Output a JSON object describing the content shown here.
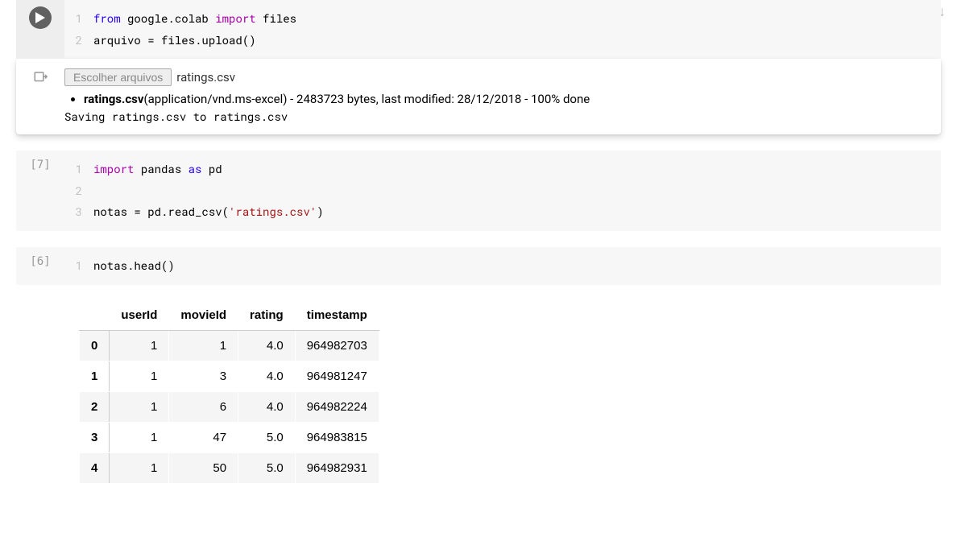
{
  "nav": {
    "up_glyph": "↑",
    "down_glyph": "↓"
  },
  "cell1": {
    "code_lines": [
      {
        "n": "1",
        "parts": [
          {
            "t": "from ",
            "cls": "kw"
          },
          {
            "t": "google.colab ",
            "cls": ""
          },
          {
            "t": "import ",
            "cls": "kw2"
          },
          {
            "t": "files",
            "cls": ""
          }
        ]
      },
      {
        "n": "2",
        "parts": [
          {
            "t": "arquivo = files.upload()",
            "cls": ""
          }
        ]
      }
    ],
    "choose_label": "Escolher arquivos",
    "chosen_file": "ratings.csv",
    "file_detail_name": "ratings.csv",
    "file_detail_meta": "(application/vnd.ms-excel) - 2483723 bytes, last modified: 28/12/2018 - 100% done",
    "saving_line": "Saving ratings.csv to ratings.csv"
  },
  "cell2": {
    "exec_label": "[7]",
    "code_lines": [
      {
        "n": "1",
        "parts": [
          {
            "t": "import ",
            "cls": "kw2"
          },
          {
            "t": "pandas ",
            "cls": ""
          },
          {
            "t": "as ",
            "cls": "kw"
          },
          {
            "t": "pd",
            "cls": ""
          }
        ]
      },
      {
        "n": "2",
        "parts": [
          {
            "t": "",
            "cls": ""
          }
        ]
      },
      {
        "n": "3",
        "parts": [
          {
            "t": "notas = pd.read_csv(",
            "cls": ""
          },
          {
            "t": "'ratings.csv'",
            "cls": "str"
          },
          {
            "t": ")",
            "cls": ""
          }
        ]
      }
    ]
  },
  "cell3": {
    "exec_label": "[6]",
    "code_lines": [
      {
        "n": "1",
        "parts": [
          {
            "t": "notas.head()",
            "cls": ""
          }
        ]
      }
    ],
    "table": {
      "columns": [
        "userId",
        "movieId",
        "rating",
        "timestamp"
      ],
      "index": [
        "0",
        "1",
        "2",
        "3",
        "4"
      ],
      "rows": [
        [
          "1",
          "1",
          "4.0",
          "964982703"
        ],
        [
          "1",
          "3",
          "4.0",
          "964981247"
        ],
        [
          "1",
          "6",
          "4.0",
          "964982224"
        ],
        [
          "1",
          "47",
          "5.0",
          "964983815"
        ],
        [
          "1",
          "50",
          "5.0",
          "964982931"
        ]
      ]
    }
  }
}
